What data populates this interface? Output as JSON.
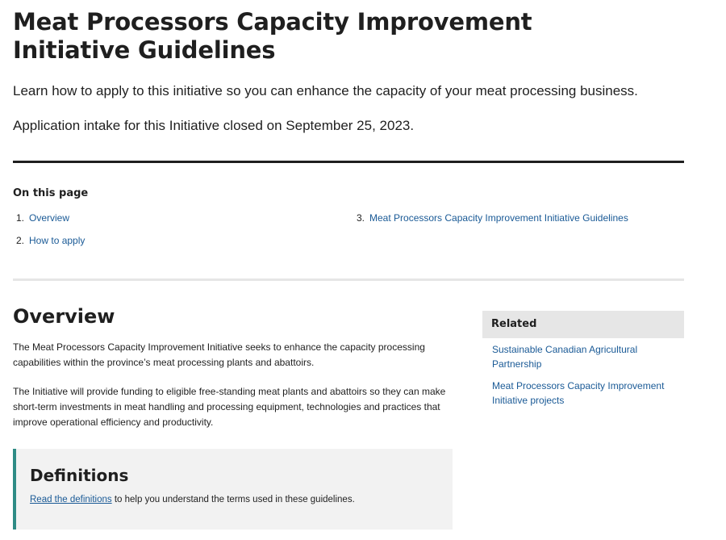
{
  "page": {
    "title": "Meat Processors Capacity Improvement Initiative Guidelines",
    "lead": "Learn how to apply to this initiative so you can enhance the capacity of your meat processing business.",
    "intake_notice": "Application intake for this Initiative closed on September 25, 2023."
  },
  "on_this_page": {
    "heading": "On this page",
    "items": [
      {
        "number": "1.",
        "label": "Overview"
      },
      {
        "number": "2.",
        "label": "How to apply"
      },
      {
        "number": "3.",
        "label": "Meat Processors Capacity Improvement Initiative Guidelines"
      }
    ]
  },
  "overview": {
    "heading": "Overview",
    "paragraphs": [
      "The Meat Processors Capacity Improvement Initiative seeks to enhance the capacity processing capabilities within the province’s meat processing plants and abattoirs.",
      "The Initiative will provide funding to eligible free-standing meat plants and abattoirs so they can make short-term investments in meat handling and processing equipment, technologies and practices that improve operational efficiency and productivity."
    ]
  },
  "definitions": {
    "heading": "Definitions",
    "link_text": "Read the definitions",
    "text_after": " to help you understand the terms used in these guidelines."
  },
  "related": {
    "heading": "Related",
    "links": [
      "Sustainable Canadian Agricultural Partnership",
      "Meat Processors Capacity Improvement Initiative projects"
    ]
  },
  "colors": {
    "link": "#1a5a96",
    "callout_accent": "#2e8b85",
    "text": "#1f1f1f"
  }
}
